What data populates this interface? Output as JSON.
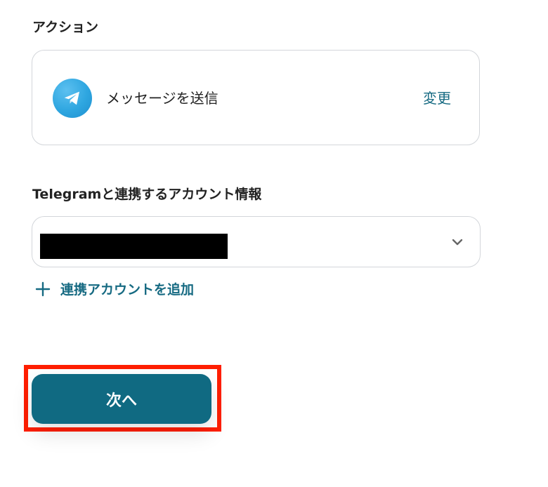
{
  "action_section": {
    "label": "アクション",
    "action_name": "メッセージを送信",
    "change_label": "変更",
    "icon": "telegram-icon"
  },
  "account_section": {
    "label": "Telegramと連携するアカウント情報",
    "add_account_label": "連携アカウントを追加"
  },
  "footer": {
    "next_label": "次へ"
  },
  "colors": {
    "accent": "#106a82",
    "highlight": "#ff1e00",
    "telegram_blue": "#2ea6e0"
  }
}
